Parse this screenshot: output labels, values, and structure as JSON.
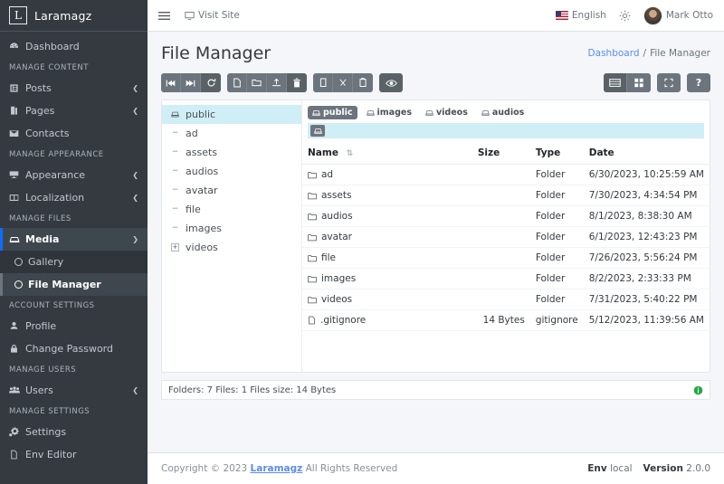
{
  "brand": {
    "logo_letter": "L",
    "name": "Laramagz"
  },
  "sidebar": {
    "groups": [
      {
        "section": null,
        "items": [
          {
            "label": "Dashboard",
            "icon": "dashboard-icon",
            "caret": false
          }
        ]
      },
      {
        "section": "MANAGE CONTENT",
        "items": [
          {
            "label": "Posts",
            "icon": "posts-icon",
            "caret": true
          },
          {
            "label": "Pages",
            "icon": "pages-icon",
            "caret": true
          },
          {
            "label": "Contacts",
            "icon": "contacts-icon",
            "caret": false
          }
        ]
      },
      {
        "section": "MANAGE APPEARANCE",
        "items": [
          {
            "label": "Appearance",
            "icon": "appearance-icon",
            "caret": true
          },
          {
            "label": "Localization",
            "icon": "localization-icon",
            "caret": true
          }
        ]
      },
      {
        "section": "MANAGE FILES",
        "items": [
          {
            "label": "Media",
            "icon": "media-icon",
            "caret": true,
            "active": true
          }
        ]
      },
      {
        "section": "ACCOUNT SETTINGS",
        "items": [
          {
            "label": "Profile",
            "icon": "profile-icon",
            "caret": false
          },
          {
            "label": "Change Password",
            "icon": "lock-icon",
            "caret": false
          }
        ]
      },
      {
        "section": "MANAGE USERS",
        "items": [
          {
            "label": "Users",
            "icon": "users-icon",
            "caret": true
          }
        ]
      },
      {
        "section": "MANAGE SETTINGS",
        "items": [
          {
            "label": "Settings",
            "icon": "settings-icon",
            "caret": false
          },
          {
            "label": "Env Editor",
            "icon": "file-icon",
            "caret": false
          }
        ]
      }
    ],
    "submenu": [
      {
        "label": "Gallery",
        "active": false
      },
      {
        "label": "File Manager",
        "active": true
      }
    ]
  },
  "navbar": {
    "menu_toggle": "hamburger-icon",
    "visit_site": "Visit Site",
    "language": "English",
    "theme_icon": "sun-icon",
    "user": "Mark Otto"
  },
  "header": {
    "title": "File Manager",
    "breadcrumb_home": "Dashboard",
    "breadcrumb_sep": "/",
    "breadcrumb_current": "File Manager"
  },
  "toolbar": {
    "groups": [
      {
        "buttons": [
          {
            "name": "back-to-first-icon",
            "glyph": "⏮"
          },
          {
            "name": "forward-to-last-icon",
            "glyph": "⏭"
          },
          {
            "name": "refresh-icon",
            "glyph": "⟳",
            "active": true
          }
        ]
      },
      {
        "buttons": [
          {
            "name": "new-file-icon",
            "glyph": "file"
          },
          {
            "name": "new-folder-icon",
            "glyph": "folder"
          },
          {
            "name": "upload-icon",
            "glyph": "upload"
          },
          {
            "name": "delete-icon",
            "glyph": "trash",
            "active": true
          }
        ]
      },
      {
        "buttons": [
          {
            "name": "copy-icon",
            "glyph": "copy"
          },
          {
            "name": "cut-icon",
            "glyph": "✂"
          },
          {
            "name": "paste-icon",
            "glyph": "paste"
          }
        ]
      },
      {
        "buttons": [
          {
            "name": "preview-icon",
            "glyph": "eye",
            "active": true
          }
        ]
      }
    ],
    "right_groups": [
      {
        "buttons": [
          {
            "name": "list-view-icon",
            "glyph": "list",
            "active": true
          },
          {
            "name": "grid-view-icon",
            "glyph": "grid"
          }
        ]
      },
      {
        "buttons": [
          {
            "name": "fullscreen-icon",
            "glyph": "expand"
          }
        ]
      },
      {
        "buttons": [
          {
            "name": "help-icon",
            "glyph": "?"
          }
        ]
      }
    ]
  },
  "tree": [
    {
      "label": "public",
      "toggle": "drive",
      "selected": true
    },
    {
      "label": "ad",
      "toggle": "dash"
    },
    {
      "label": "assets",
      "toggle": "dash"
    },
    {
      "label": "audios",
      "toggle": "dash"
    },
    {
      "label": "avatar",
      "toggle": "dash"
    },
    {
      "label": "file",
      "toggle": "dash"
    },
    {
      "label": "images",
      "toggle": "dash"
    },
    {
      "label": "videos",
      "toggle": "plus"
    }
  ],
  "crumbs": [
    {
      "label": "public",
      "active": true
    },
    {
      "label": "images",
      "active": false
    },
    {
      "label": "videos",
      "active": false
    },
    {
      "label": "audios",
      "active": false
    }
  ],
  "pathbar": {
    "icon": "drive-icon",
    "value": ""
  },
  "table": {
    "columns": [
      "Name",
      "Size",
      "Type",
      "Date"
    ],
    "sort_icon": "sort-asc-icon",
    "rows": [
      {
        "icon": "folder-icon",
        "name": "ad",
        "size": "",
        "type": "Folder",
        "date": "6/30/2023, 10:25:59 AM"
      },
      {
        "icon": "folder-icon",
        "name": "assets",
        "size": "",
        "type": "Folder",
        "date": "7/30/2023, 4:34:54 PM"
      },
      {
        "icon": "folder-icon",
        "name": "audios",
        "size": "",
        "type": "Folder",
        "date": "8/1/2023, 8:38:30 AM"
      },
      {
        "icon": "folder-icon",
        "name": "avatar",
        "size": "",
        "type": "Folder",
        "date": "6/1/2023, 12:43:23 PM"
      },
      {
        "icon": "folder-icon",
        "name": "file",
        "size": "",
        "type": "Folder",
        "date": "7/26/2023, 5:56:24 PM"
      },
      {
        "icon": "folder-icon",
        "name": "images",
        "size": "",
        "type": "Folder",
        "date": "8/2/2023, 2:33:33 PM"
      },
      {
        "icon": "folder-icon",
        "name": "videos",
        "size": "",
        "type": "Folder",
        "date": "7/31/2023, 5:40:22 PM"
      },
      {
        "icon": "file-icon",
        "name": ".gitignore",
        "size": "14 Bytes",
        "type": "gitignore",
        "date": "5/12/2023, 11:39:56 AM"
      }
    ]
  },
  "status": {
    "text": "Folders: 7 Files: 1 Files size: 14 Bytes",
    "icon": "info-icon",
    "icon_color": "#28a745"
  },
  "footer": {
    "copyright_prefix": "Copyright © 2023",
    "brand": "Laramagz",
    "rights": "All Rights Reserved",
    "env_label": "Env",
    "env_value": "local",
    "version_label": "Version",
    "version_value": "2.0.0"
  },
  "colors": {
    "sidebar": "#343a40",
    "accent": "#0d6efd",
    "link": "#5b8def",
    "selection": "#cfeef5",
    "toolbar": "#6c757d"
  }
}
